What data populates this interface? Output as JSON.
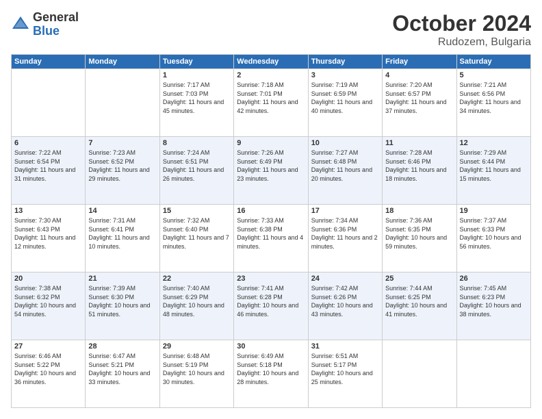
{
  "header": {
    "logo_general": "General",
    "logo_blue": "Blue",
    "month": "October 2024",
    "location": "Rudozem, Bulgaria"
  },
  "weekdays": [
    "Sunday",
    "Monday",
    "Tuesday",
    "Wednesday",
    "Thursday",
    "Friday",
    "Saturday"
  ],
  "weeks": [
    [
      {
        "day": "",
        "info": ""
      },
      {
        "day": "",
        "info": ""
      },
      {
        "day": "1",
        "info": "Sunrise: 7:17 AM\nSunset: 7:03 PM\nDaylight: 11 hours and 45 minutes."
      },
      {
        "day": "2",
        "info": "Sunrise: 7:18 AM\nSunset: 7:01 PM\nDaylight: 11 hours and 42 minutes."
      },
      {
        "day": "3",
        "info": "Sunrise: 7:19 AM\nSunset: 6:59 PM\nDaylight: 11 hours and 40 minutes."
      },
      {
        "day": "4",
        "info": "Sunrise: 7:20 AM\nSunset: 6:57 PM\nDaylight: 11 hours and 37 minutes."
      },
      {
        "day": "5",
        "info": "Sunrise: 7:21 AM\nSunset: 6:56 PM\nDaylight: 11 hours and 34 minutes."
      }
    ],
    [
      {
        "day": "6",
        "info": "Sunrise: 7:22 AM\nSunset: 6:54 PM\nDaylight: 11 hours and 31 minutes."
      },
      {
        "day": "7",
        "info": "Sunrise: 7:23 AM\nSunset: 6:52 PM\nDaylight: 11 hours and 29 minutes."
      },
      {
        "day": "8",
        "info": "Sunrise: 7:24 AM\nSunset: 6:51 PM\nDaylight: 11 hours and 26 minutes."
      },
      {
        "day": "9",
        "info": "Sunrise: 7:26 AM\nSunset: 6:49 PM\nDaylight: 11 hours and 23 minutes."
      },
      {
        "day": "10",
        "info": "Sunrise: 7:27 AM\nSunset: 6:48 PM\nDaylight: 11 hours and 20 minutes."
      },
      {
        "day": "11",
        "info": "Sunrise: 7:28 AM\nSunset: 6:46 PM\nDaylight: 11 hours and 18 minutes."
      },
      {
        "day": "12",
        "info": "Sunrise: 7:29 AM\nSunset: 6:44 PM\nDaylight: 11 hours and 15 minutes."
      }
    ],
    [
      {
        "day": "13",
        "info": "Sunrise: 7:30 AM\nSunset: 6:43 PM\nDaylight: 11 hours and 12 minutes."
      },
      {
        "day": "14",
        "info": "Sunrise: 7:31 AM\nSunset: 6:41 PM\nDaylight: 11 hours and 10 minutes."
      },
      {
        "day": "15",
        "info": "Sunrise: 7:32 AM\nSunset: 6:40 PM\nDaylight: 11 hours and 7 minutes."
      },
      {
        "day": "16",
        "info": "Sunrise: 7:33 AM\nSunset: 6:38 PM\nDaylight: 11 hours and 4 minutes."
      },
      {
        "day": "17",
        "info": "Sunrise: 7:34 AM\nSunset: 6:36 PM\nDaylight: 11 hours and 2 minutes."
      },
      {
        "day": "18",
        "info": "Sunrise: 7:36 AM\nSunset: 6:35 PM\nDaylight: 10 hours and 59 minutes."
      },
      {
        "day": "19",
        "info": "Sunrise: 7:37 AM\nSunset: 6:33 PM\nDaylight: 10 hours and 56 minutes."
      }
    ],
    [
      {
        "day": "20",
        "info": "Sunrise: 7:38 AM\nSunset: 6:32 PM\nDaylight: 10 hours and 54 minutes."
      },
      {
        "day": "21",
        "info": "Sunrise: 7:39 AM\nSunset: 6:30 PM\nDaylight: 10 hours and 51 minutes."
      },
      {
        "day": "22",
        "info": "Sunrise: 7:40 AM\nSunset: 6:29 PM\nDaylight: 10 hours and 48 minutes."
      },
      {
        "day": "23",
        "info": "Sunrise: 7:41 AM\nSunset: 6:28 PM\nDaylight: 10 hours and 46 minutes."
      },
      {
        "day": "24",
        "info": "Sunrise: 7:42 AM\nSunset: 6:26 PM\nDaylight: 10 hours and 43 minutes."
      },
      {
        "day": "25",
        "info": "Sunrise: 7:44 AM\nSunset: 6:25 PM\nDaylight: 10 hours and 41 minutes."
      },
      {
        "day": "26",
        "info": "Sunrise: 7:45 AM\nSunset: 6:23 PM\nDaylight: 10 hours and 38 minutes."
      }
    ],
    [
      {
        "day": "27",
        "info": "Sunrise: 6:46 AM\nSunset: 5:22 PM\nDaylight: 10 hours and 36 minutes."
      },
      {
        "day": "28",
        "info": "Sunrise: 6:47 AM\nSunset: 5:21 PM\nDaylight: 10 hours and 33 minutes."
      },
      {
        "day": "29",
        "info": "Sunrise: 6:48 AM\nSunset: 5:19 PM\nDaylight: 10 hours and 30 minutes."
      },
      {
        "day": "30",
        "info": "Sunrise: 6:49 AM\nSunset: 5:18 PM\nDaylight: 10 hours and 28 minutes."
      },
      {
        "day": "31",
        "info": "Sunrise: 6:51 AM\nSunset: 5:17 PM\nDaylight: 10 hours and 25 minutes."
      },
      {
        "day": "",
        "info": ""
      },
      {
        "day": "",
        "info": ""
      }
    ]
  ]
}
